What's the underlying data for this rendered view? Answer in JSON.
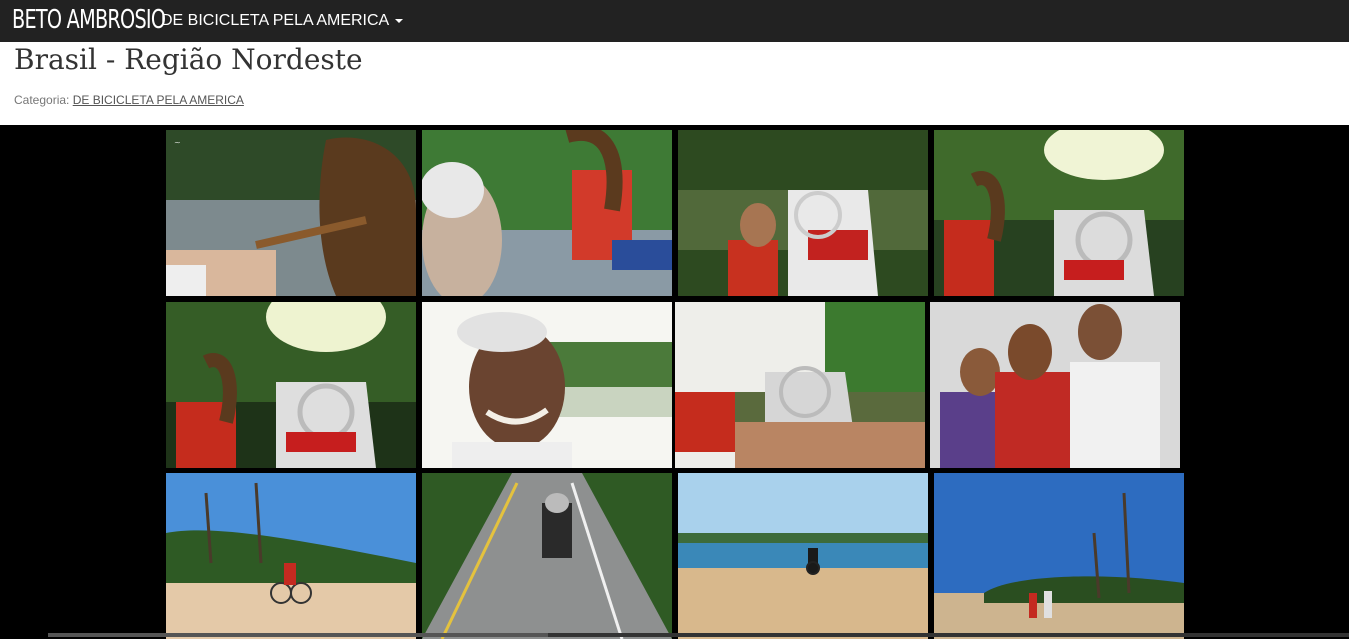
{
  "nav": {
    "brand": "BETO AMBROSIO",
    "menu_label": "DE BICICLETA PELA AMERICA"
  },
  "page": {
    "title": "Brasil - Região Nordeste",
    "category_label": "Categoria:",
    "category_link": "DE BICICLETA PELA AMERICA"
  },
  "gallery": {
    "photos": [
      {
        "desc": "hand pulling dreadlocks on boat"
      },
      {
        "desc": "elderly man and traveler on boat"
      },
      {
        "desc": "smiling traveler with bicycle on boat"
      },
      {
        "desc": "traveler with bicycle on boat through mangrove"
      },
      {
        "desc": "bicycle on boat in mangrove river"
      },
      {
        "desc": "smiling elderly woman by river"
      },
      {
        "desc": "bicycle on boat near riverbank"
      },
      {
        "desc": "three people smiling portrait"
      },
      {
        "desc": "cyclist on beach with palm trees"
      },
      {
        "desc": "loaded bicycle on road"
      },
      {
        "desc": "cyclist on sandy beach"
      },
      {
        "desc": "two cyclists on beach with palms"
      }
    ]
  }
}
